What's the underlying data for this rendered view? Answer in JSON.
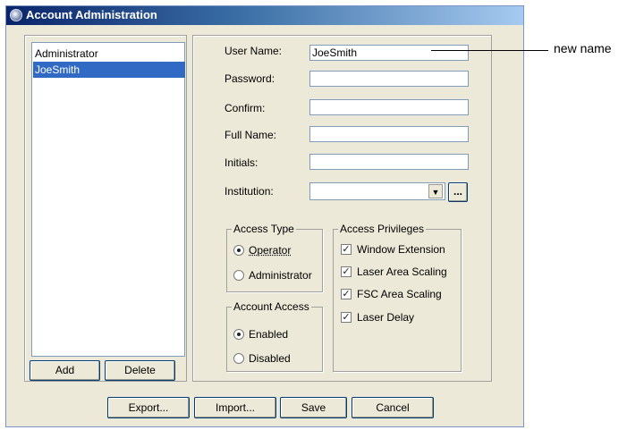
{
  "window": {
    "title": "Account Administration"
  },
  "users": {
    "items": [
      {
        "label": "Administrator",
        "selected": false
      },
      {
        "label": "JoeSmith",
        "selected": true
      }
    ],
    "add_label": "Add",
    "delete_label": "Delete"
  },
  "form": {
    "user_name_label": "User Name:",
    "user_name_value": "JoeSmith",
    "password_label": "Password:",
    "confirm_label": "Confirm:",
    "full_name_label": "Full Name:",
    "initials_label": "Initials:",
    "institution_label": "Institution:",
    "institution_browse_label": "...",
    "institution_dropdown_icon": "▼"
  },
  "access_type": {
    "legend": "Access Type",
    "options": [
      {
        "label": "Operator",
        "selected": true
      },
      {
        "label": "Administrator",
        "selected": false
      }
    ]
  },
  "account_access": {
    "legend": "Account Access",
    "options": [
      {
        "label": "Enabled",
        "selected": true
      },
      {
        "label": "Disabled",
        "selected": false
      }
    ]
  },
  "access_privileges": {
    "legend": "Access Privileges",
    "options": [
      {
        "label": "Window Extension",
        "checked": true
      },
      {
        "label": "Laser Area Scaling",
        "checked": true
      },
      {
        "label": "FSC Area Scaling",
        "checked": true
      },
      {
        "label": "Laser Delay",
        "checked": true
      }
    ]
  },
  "footer": {
    "export_label": "Export...",
    "import_label": "Import...",
    "save_label": "Save",
    "cancel_label": "Cancel"
  },
  "callout": {
    "text": "new name"
  },
  "check_glyph": "✓"
}
